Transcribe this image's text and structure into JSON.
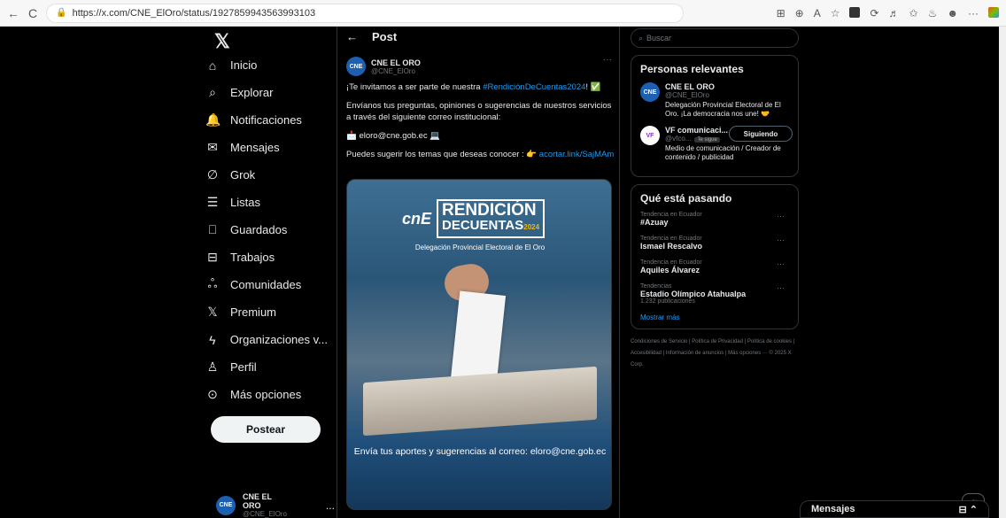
{
  "browser": {
    "url": "https://x.com/CNE_ElOro/status/1927859943563993103",
    "back_icon": "←",
    "refresh_icon": "C"
  },
  "sidebar": {
    "logo": "𝕏",
    "items": [
      {
        "icon": "⌂",
        "label": "Inicio"
      },
      {
        "icon": "⌕",
        "label": "Explorar"
      },
      {
        "icon": "🔔",
        "label": "Notificaciones"
      },
      {
        "icon": "✉",
        "label": "Mensajes"
      },
      {
        "icon": "∅",
        "label": "Grok"
      },
      {
        "icon": "☰",
        "label": "Listas"
      },
      {
        "icon": "⎕",
        "label": "Guardados"
      },
      {
        "icon": "⊟",
        "label": "Trabajos"
      },
      {
        "icon": "ஃ",
        "label": "Comunidades"
      },
      {
        "icon": "𝕏",
        "label": "Premium"
      },
      {
        "icon": "ϟ",
        "label": "Organizaciones v..."
      },
      {
        "icon": "♙",
        "label": "Perfil"
      },
      {
        "icon": "⊙",
        "label": "Más opciones"
      }
    ],
    "post_button": "Postear",
    "account": {
      "name": "CNE EL ORO",
      "handle": "@CNE_ElOro",
      "more": "..."
    }
  },
  "main": {
    "back": "←",
    "title": "Post",
    "author": {
      "name": "CNE EL ORO",
      "handle": "@CNE_ElOro",
      "more": "···"
    },
    "text1_pre": "¡Te invitamos a ser parte de nuestra ",
    "text1_tag": "#RendiciónDeCuentas2024",
    "text1_post": "! ✅",
    "text2": "Envíanos tus preguntas, opiniones o sugerencias de nuestros servicios a través del siguiente correo institucional:",
    "text3": "📩 eloro@cne.gob.ec 💻",
    "text4_pre": "Puedes sugerir los temas que deseas conocer : 👉 ",
    "text4_link": "acortar.link/SajMAm",
    "media": {
      "logo": "cnE",
      "rend_line1": "RENDICIÓN",
      "rend_line2": "DECUENTAS",
      "rend_year": "2024",
      "delegation": "Delegación Provincial Electoral de El Oro",
      "caption": "Envía tus aportes y sugerencias al correo: eloro@cne.gob.ec"
    }
  },
  "right": {
    "search_placeholder": "Buscar",
    "relevant_title": "Personas relevantes",
    "people": [
      {
        "name": "CNE EL ORO",
        "handle": "@CNE_ElOro",
        "bio": "Delegación Provincial Electoral de El Oro. ¡La democracia nos une! 🤝"
      },
      {
        "name": "VF comunicaci...",
        "handle": "@vfco...",
        "badge": "Te sigue",
        "follow": "Siguiendo",
        "bio": "Medio de comunicación / Creador de contenido / publicidad"
      }
    ],
    "trends_title": "Qué está pasando",
    "trends": [
      {
        "context": "Tendencia en Ecuador",
        "topic": "#Azuay",
        "posts": ""
      },
      {
        "context": "Tendencia en Ecuador",
        "topic": "Ismael Rescalvo",
        "posts": ""
      },
      {
        "context": "Tendencia en Ecuador",
        "topic": "Aquiles Álvarez",
        "posts": ""
      },
      {
        "context": "Tendencias",
        "topic": "Estadio Olímpico Atahualpa",
        "posts": "1.232 publicaciones"
      }
    ],
    "show_more": "Mostrar más",
    "footer": "Condiciones de Servicio | Política de Privacidad | Política de cookies | Accesibilidad | Información de anuncios | Más opciones ··· © 2025 X Corp."
  },
  "messages_label": "Mensajes",
  "grok_icon": "∅",
  "colors": {
    "accent": "#1d9bf0",
    "bg": "#000000",
    "border": "#2f3336"
  }
}
